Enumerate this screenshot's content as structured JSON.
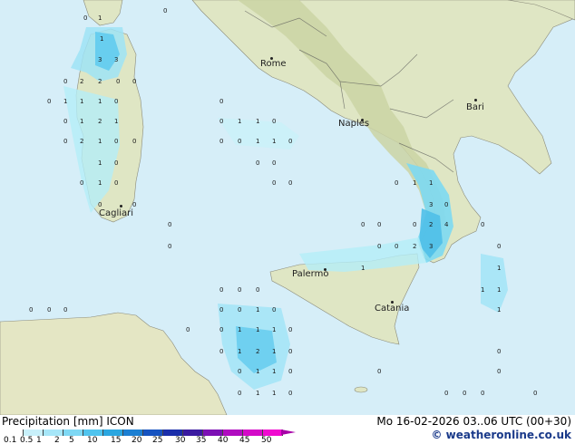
{
  "map": {
    "cities": [
      {
        "name": "Rome"
      },
      {
        "name": "Naples"
      },
      {
        "name": "Bari"
      },
      {
        "name": "Cagliari"
      },
      {
        "name": "Palermo"
      },
      {
        "name": "Catania"
      }
    ],
    "colors": {
      "sea": "#d6eef8",
      "land": "#dfe6c4",
      "hills": "#c9cf9f",
      "precip_light": "#b4eef8",
      "precip_medium": "#7dd9f2",
      "precip_heavy": "#55c4ec"
    }
  },
  "footer": {
    "title": "Precipitation [mm]  ICON",
    "datetime": "Mo 16-02-2026 03..06 UTC (00+30)",
    "credit": "© weatheronline.co.uk"
  },
  "legend": {
    "labels": [
      "0.1",
      "0.5",
      "1",
      "2",
      "5",
      "10",
      "15",
      "20",
      "25",
      "30",
      "35",
      "40",
      "45",
      "50"
    ],
    "colors": [
      "#ffffff",
      "#c8f0fa",
      "#a6e6f8",
      "#7ed8f4",
      "#50c4ee",
      "#2aa6e0",
      "#1c7fd2",
      "#1653c0",
      "#1a2eaa",
      "#3a1aa0",
      "#7c10b4",
      "#b00cc0",
      "#d40ac8",
      "#f00ad0"
    ]
  }
}
